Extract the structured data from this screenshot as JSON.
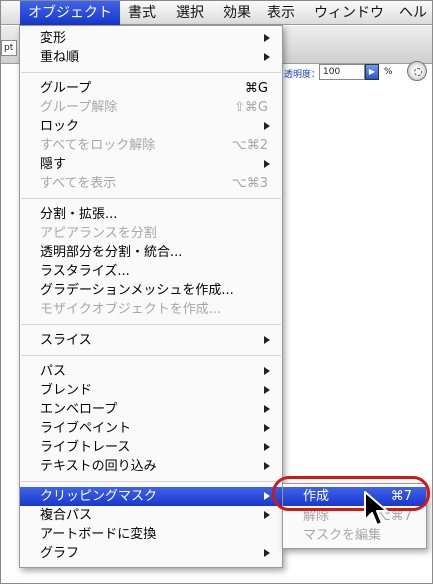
{
  "menubar": {
    "items": [
      {
        "label": "オブジェクト",
        "active": true
      },
      {
        "label": "書式"
      },
      {
        "label": "選択"
      },
      {
        "label": "効果"
      },
      {
        "label": "表示"
      },
      {
        "label": "ウィンドウ"
      },
      {
        "label": "ヘル"
      }
    ]
  },
  "controlbar": {
    "unit_field": "pt",
    "opacity_label": "透明度：",
    "opacity_value": "100",
    "percent": "%"
  },
  "menu": {
    "items": [
      {
        "label": "変形",
        "submenu": true
      },
      {
        "label": "重ね順",
        "submenu": true
      },
      {
        "label": "グループ",
        "shortcut": "⌘G"
      },
      {
        "label": "グループ解除",
        "shortcut": "⇧⌘G",
        "disabled": true
      },
      {
        "label": "ロック",
        "submenu": true
      },
      {
        "label": "すべてをロック解除",
        "shortcut": "⌥⌘2",
        "disabled": true
      },
      {
        "label": "隠す",
        "submenu": true
      },
      {
        "label": "すべてを表示",
        "shortcut": "⌥⌘3",
        "disabled": true
      },
      {
        "label": "分割・拡張..."
      },
      {
        "label": "アピアランスを分割",
        "disabled": true
      },
      {
        "label": "透明部分を分割・統合..."
      },
      {
        "label": "ラスタライズ..."
      },
      {
        "label": "グラデーションメッシュを作成..."
      },
      {
        "label": "モザイクオブジェクトを作成...",
        "disabled": true
      },
      {
        "label": "スライス",
        "submenu": true
      },
      {
        "label": "パス",
        "submenu": true
      },
      {
        "label": "ブレンド",
        "submenu": true
      },
      {
        "label": "エンベロープ",
        "submenu": true
      },
      {
        "label": "ライブペイント",
        "submenu": true
      },
      {
        "label": "ライブトレース",
        "submenu": true
      },
      {
        "label": "テキストの回り込み",
        "submenu": true
      },
      {
        "label": "クリッピングマスク",
        "submenu": true,
        "highlight": true
      },
      {
        "label": "複合パス",
        "submenu": true
      },
      {
        "label": "アートボードに変換"
      },
      {
        "label": "グラフ",
        "submenu": true
      }
    ]
  },
  "submenu": {
    "items": [
      {
        "label": "作成",
        "shortcut": "⌘7",
        "highlight": true
      },
      {
        "label": "解除",
        "shortcut": "⌥⌘7",
        "disabled": true
      },
      {
        "label": "マスクを編集",
        "disabled": true
      }
    ]
  },
  "colors": {
    "highlight": "#2447d9",
    "callout": "#d01818",
    "disabled_text": "#a7a7a7"
  }
}
